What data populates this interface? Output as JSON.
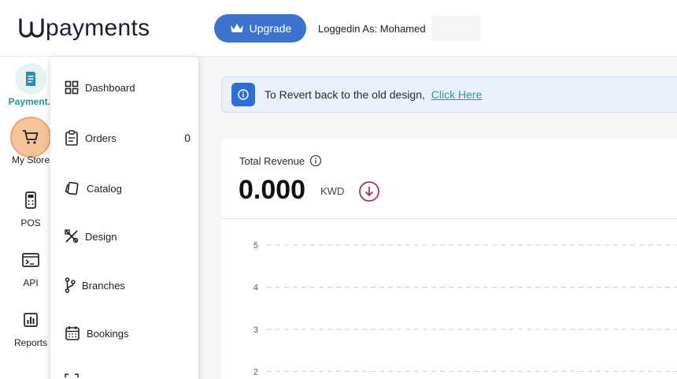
{
  "brand": {
    "name": "payments"
  },
  "topbar": {
    "upgrade_label": "Upgrade",
    "logged_in": "Loggedin As: Mohamed"
  },
  "rail": [
    {
      "key": "payments",
      "label": "Payment..",
      "icon": "receipt-icon",
      "active": true
    },
    {
      "key": "mystore",
      "label": "My Store",
      "icon": "cart-icon",
      "highlight": true
    },
    {
      "key": "pos",
      "label": "POS",
      "icon": "pos-terminal-icon"
    },
    {
      "key": "api",
      "label": "API",
      "icon": "terminal-icon"
    },
    {
      "key": "reports",
      "label": "Reports",
      "icon": "bar-chart-icon"
    }
  ],
  "menu": [
    {
      "key": "dashboard",
      "label": "Dashboard",
      "icon": "grid-icon"
    },
    {
      "key": "orders",
      "label": "Orders",
      "icon": "clipboard-icon",
      "count": "0"
    },
    {
      "key": "catalog",
      "label": "Catalog",
      "icon": "cards-icon"
    },
    {
      "key": "design",
      "label": "Design",
      "icon": "tools-icon"
    },
    {
      "key": "branches",
      "label": "Branches",
      "icon": "branch-icon"
    },
    {
      "key": "bookings",
      "label": "Bookings",
      "icon": "calendar-icon"
    }
  ],
  "notice": {
    "text": "To Revert back to the old design,",
    "link": "Click Here"
  },
  "revenue": {
    "title": "Total Revenue",
    "value": "0.000",
    "currency": "KWD"
  },
  "chart_data": {
    "type": "line",
    "y_ticks": [
      "5",
      "4",
      "3",
      "2"
    ],
    "ylim": [
      0,
      5
    ],
    "grid": true,
    "series": []
  },
  "colors": {
    "accent": "#3c73cf",
    "teal": "#2c8ea7",
    "highlight": "#f6c49a",
    "down": "#a33a4a"
  }
}
